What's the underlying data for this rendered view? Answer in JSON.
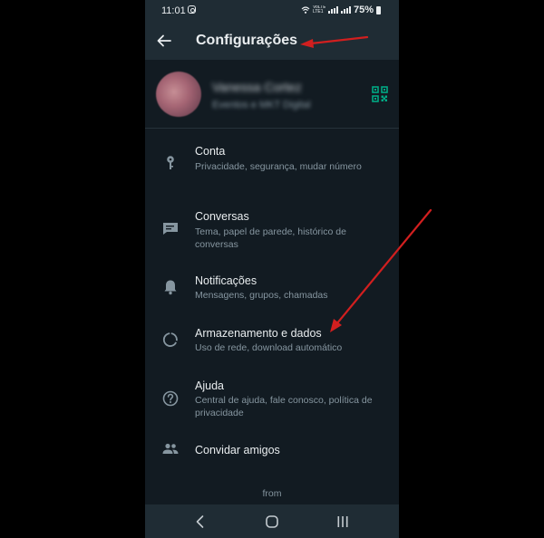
{
  "status_bar": {
    "time": "11:01",
    "network_label": "VoLTE LTE1",
    "battery": "75%"
  },
  "header": {
    "title": "Configurações"
  },
  "profile": {
    "name": "Vanessa Cortez",
    "about": "Eventos e MKT Digital"
  },
  "settings": [
    {
      "title": "Conta",
      "subtitle": "Privacidade, segurança, mudar número",
      "icon": "key-icon"
    },
    {
      "title": "Conversas",
      "subtitle": "Tema, papel de parede, histórico de conversas",
      "icon": "chat-icon"
    },
    {
      "title": "Notificações",
      "subtitle": "Mensagens, grupos, chamadas",
      "icon": "bell-icon"
    },
    {
      "title": "Armazenamento e dados",
      "subtitle": "Uso de rede, download automático",
      "icon": "data-usage-icon"
    },
    {
      "title": "Ajuda",
      "subtitle": "Central de ajuda, fale conosco, política de privacidade",
      "icon": "help-icon"
    },
    {
      "title": "Convidar amigos",
      "subtitle": "",
      "icon": "people-icon"
    }
  ],
  "footer": {
    "from": "from"
  },
  "colors": {
    "background": "#121b22",
    "header": "#1f2c34",
    "accent": "#00a884",
    "annotation_arrow": "#d11f1f"
  }
}
